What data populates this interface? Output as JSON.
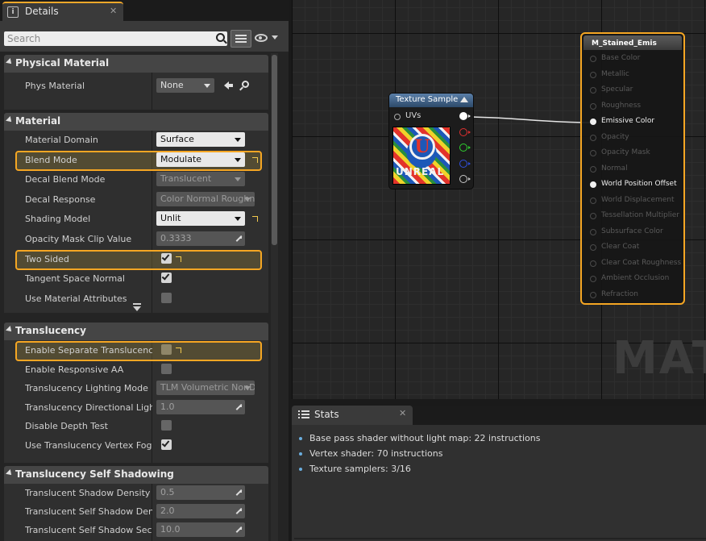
{
  "details": {
    "tab": {
      "title": "Details",
      "icon": "details-icon",
      "close": "✕"
    },
    "search": {
      "placeholder": "Search",
      "icon": "search-icon"
    },
    "toolbar": {
      "view_options_icon": "eye-icon",
      "property_matrix_icon": "grid-icon"
    },
    "categories": [
      {
        "title": "Physical Material",
        "rows": [
          {
            "label": "Phys Material",
            "type": "asset",
            "value": "None"
          }
        ]
      },
      {
        "title": "Material",
        "rows": [
          {
            "label": "Material Domain",
            "type": "dropdown",
            "value": "Surface",
            "highlight": false
          },
          {
            "label": "Blend Mode",
            "type": "dropdown",
            "value": "Modulate",
            "highlight": true,
            "reset": true
          },
          {
            "label": "Decal Blend Mode",
            "type": "dropdown",
            "value": "Translucent",
            "disabled": true
          },
          {
            "label": "Decal Response",
            "type": "dropdown",
            "value": "Color Normal Roughness",
            "disabled": true
          },
          {
            "label": "Shading Model",
            "type": "dropdown",
            "value": "Unlit",
            "reset": true
          },
          {
            "label": "Opacity Mask Clip Value",
            "type": "number",
            "value": "0.3333"
          },
          {
            "label": "Two Sided",
            "type": "checkbox",
            "checked": true,
            "highlight": true,
            "reset": true
          },
          {
            "label": "Tangent Space Normal",
            "type": "checkbox",
            "checked": true
          },
          {
            "label": "Use Material Attributes",
            "type": "checkbox",
            "checked": false
          }
        ]
      },
      {
        "title": "Translucency",
        "rows": [
          {
            "label": "Enable Separate Translucency",
            "type": "checkbox",
            "checked": false,
            "highlight": true,
            "reset": true
          },
          {
            "label": "Enable Responsive AA",
            "type": "checkbox",
            "checked": false
          },
          {
            "label": "Translucency Lighting Mode",
            "type": "dropdown",
            "value": "TLM Volumetric NonDirectional",
            "disabled": true
          },
          {
            "label": "Translucency Directional Lighting Intensity",
            "type": "number",
            "value": "1.0"
          },
          {
            "label": "Disable Depth Test",
            "type": "checkbox",
            "checked": false
          },
          {
            "label": "Use Translucency Vertex Fog",
            "type": "checkbox",
            "checked": true
          }
        ]
      },
      {
        "title": "Translucency Self Shadowing",
        "rows": [
          {
            "label": "Translucent Shadow Density Scale",
            "type": "number",
            "value": "0.5"
          },
          {
            "label": "Translucent Self Shadow Density Scale",
            "type": "number",
            "value": "2.0"
          },
          {
            "label": "Translucent Self Shadow Second Density Scale",
            "type": "number",
            "value": "10.0"
          }
        ]
      }
    ]
  },
  "graph": {
    "watermark": "MATE",
    "texture_node": {
      "title": "Texture Sample",
      "input_label": "UVs",
      "thumbnail_text": "UNREAL",
      "outputs": [
        {
          "color": "#ffffff"
        },
        {
          "color": "#e03030"
        },
        {
          "color": "#30d030"
        },
        {
          "color": "#3050e0"
        },
        {
          "color": "#c8c8c8"
        }
      ]
    },
    "material_node": {
      "title": "M_Stained_Emis",
      "pins": [
        {
          "label": "Base Color",
          "active": false
        },
        {
          "label": "Metallic",
          "active": false
        },
        {
          "label": "Specular",
          "active": false
        },
        {
          "label": "Roughness",
          "active": false
        },
        {
          "label": "Emissive Color",
          "active": true
        },
        {
          "label": "Opacity",
          "active": false
        },
        {
          "label": "Opacity Mask",
          "active": false
        },
        {
          "label": "Normal",
          "active": false
        },
        {
          "label": "World Position Offset",
          "active": true
        },
        {
          "label": "World Displacement",
          "active": false
        },
        {
          "label": "Tessellation Multiplier",
          "active": false
        },
        {
          "label": "Subsurface Color",
          "active": false
        },
        {
          "label": "Clear Coat",
          "active": false
        },
        {
          "label": "Clear Coat Roughness",
          "active": false
        },
        {
          "label": "Ambient Occlusion",
          "active": false
        },
        {
          "label": "Refraction",
          "active": false
        }
      ]
    }
  },
  "stats": {
    "tab": {
      "title": "Stats",
      "icon": "stats-icon",
      "close": "✕"
    },
    "lines": [
      "Base pass shader without light map: 22 instructions",
      "Vertex shader: 70 instructions",
      "Texture samplers: 3/16"
    ]
  },
  "colors": {
    "highlight": "#f5a623",
    "accent_tab": "#f3a82a"
  }
}
